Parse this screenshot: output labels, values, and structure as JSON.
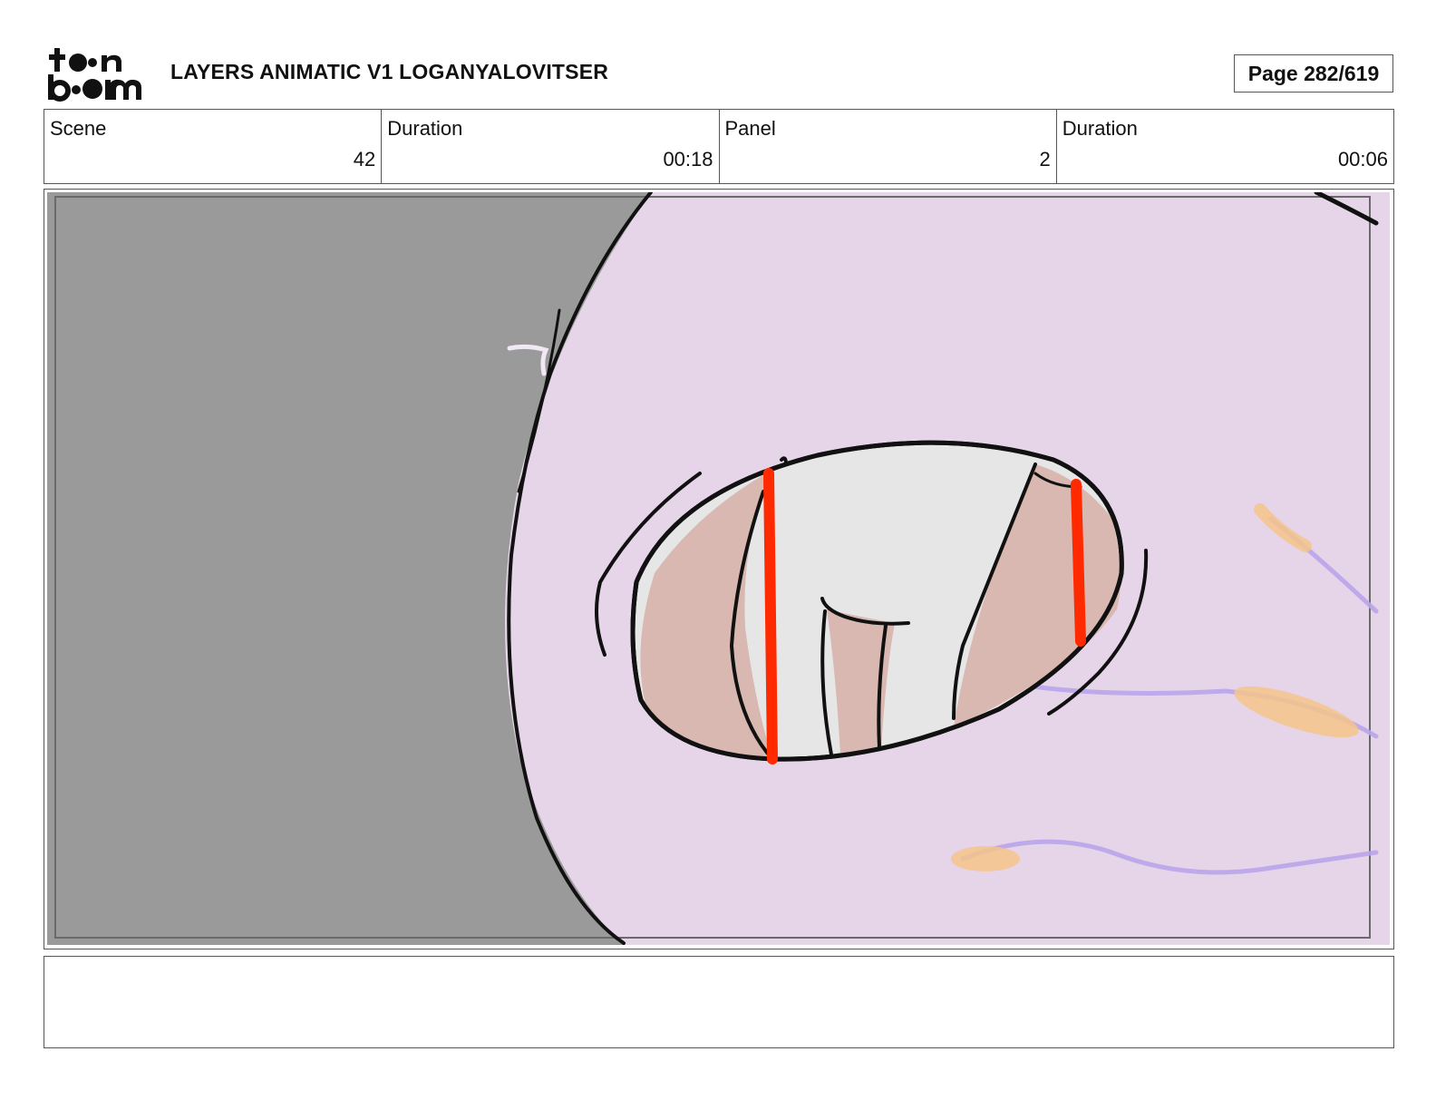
{
  "header": {
    "logo_text": "toon boom",
    "title": "LAYERS ANIMATIC V1 LOGANYALOVITSER",
    "page": "Page 282/619"
  },
  "info": {
    "scene_label": "Scene",
    "scene_value": "42",
    "scene_duration_label": "Duration",
    "scene_duration_value": "00:18",
    "panel_label": "Panel",
    "panel_value": "2",
    "panel_duration_label": "Duration",
    "panel_duration_value": "00:06"
  },
  "notes": {
    "text": ""
  },
  "colors": {
    "background_gray": "#9a9a9a",
    "skin_lavender": "#e6d4e8",
    "eye_white": "#e6e6e6",
    "iris_brown": "#d8b8b0",
    "accent_red": "#ff2a00",
    "vein_purple": "#b9a5ea",
    "blush_orange": "#f5c489"
  }
}
